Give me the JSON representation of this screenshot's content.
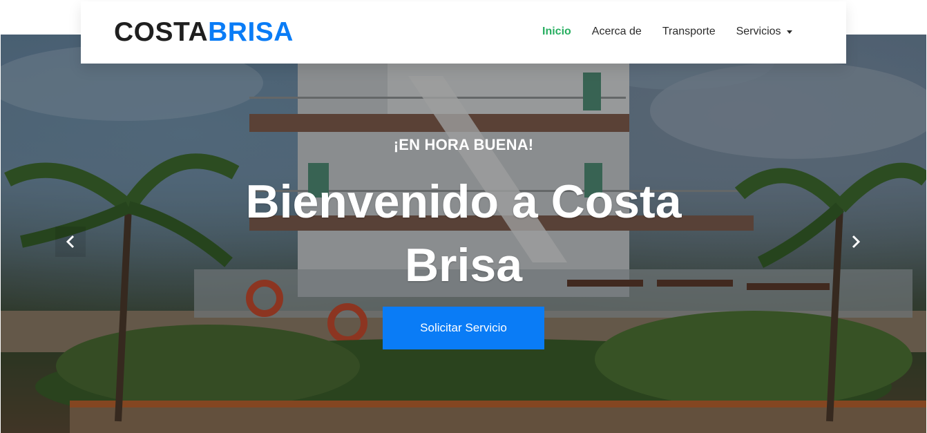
{
  "brand": {
    "part1": "COSTA",
    "part2": "BRISA"
  },
  "nav": {
    "items": [
      {
        "label": "Inicio",
        "active": true
      },
      {
        "label": "Acerca de",
        "active": false
      },
      {
        "label": "Transporte",
        "active": false
      },
      {
        "label": "Servicios",
        "active": false,
        "dropdown": true
      }
    ]
  },
  "hero": {
    "kicker": "¡EN HORA BUENA!",
    "title": "Bienvenido a Costa Brisa",
    "cta_label": "Solicitar Servicio",
    "prev_icon": "chevron-left-icon",
    "next_icon": "chevron-right-icon"
  },
  "colors": {
    "accent": "#0a7cf6",
    "active_nav": "#27ae60",
    "brand_dark": "#1f1f1f"
  }
}
